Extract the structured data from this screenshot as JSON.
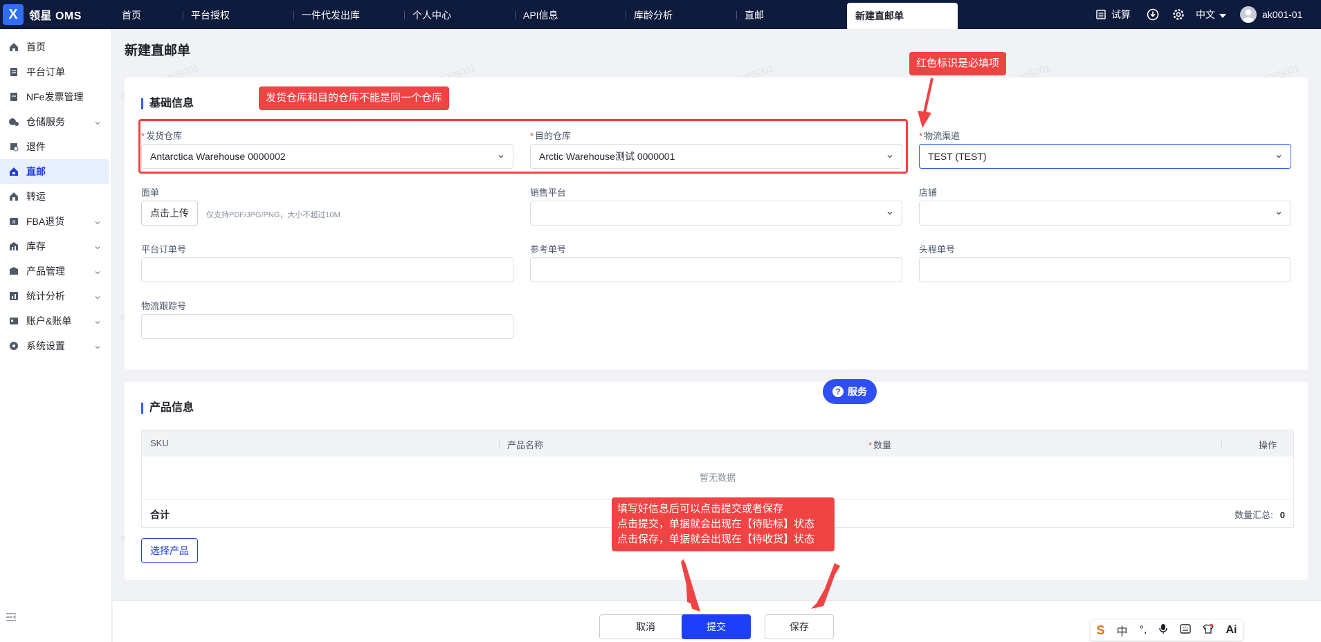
{
  "app": {
    "logo_glyph": "X",
    "name": "领星 OMS"
  },
  "topnav": {
    "items": [
      "首页",
      "平台授权",
      "一件代发出库",
      "个人中心",
      "API信息",
      "库龄分析",
      "直邮"
    ],
    "active": "新建直邮单"
  },
  "topright": {
    "trial": "试算",
    "language": "中文",
    "user": "ak001-01"
  },
  "sidebar": {
    "items": [
      {
        "label": "首页",
        "icon": "home-icon"
      },
      {
        "label": "平台订单",
        "icon": "order-icon"
      },
      {
        "label": "NFe发票管理",
        "icon": "invoice-icon"
      },
      {
        "label": "仓储服务",
        "icon": "warehouse-icon"
      },
      {
        "label": "退件",
        "icon": "return-icon"
      },
      {
        "label": "直邮",
        "icon": "direct-mail-icon"
      },
      {
        "label": "转运",
        "icon": "transfer-icon"
      },
      {
        "label": "FBA退货",
        "icon": "fba-icon"
      },
      {
        "label": "库存",
        "icon": "inventory-icon"
      },
      {
        "label": "产品管理",
        "icon": "product-icon"
      },
      {
        "label": "统计分析",
        "icon": "stats-icon"
      },
      {
        "label": "账户&账单",
        "icon": "account-icon"
      },
      {
        "label": "系统设置",
        "icon": "settings-icon"
      }
    ],
    "active_index": 5,
    "expandable": [
      3,
      7,
      8,
      9,
      10,
      11,
      12
    ]
  },
  "page": {
    "title": "新建直邮单"
  },
  "basic": {
    "title": "基础信息",
    "from_wh": {
      "label": "发货仓库",
      "value": "Antarctica Warehouse 0000002"
    },
    "to_wh": {
      "label": "目的仓库",
      "value": "Arctic Warehouse测试 0000001"
    },
    "channel": {
      "label": "物流渠道",
      "value": "TEST (TEST)"
    },
    "label_sheet": {
      "label": "面单",
      "button": "点击上传",
      "hint": "仅支持PDF/JPG/PNG，大小不超过10M"
    },
    "platform": {
      "label": "销售平台",
      "value": ""
    },
    "shop": {
      "label": "店铺",
      "value": ""
    },
    "platform_order": {
      "label": "平台订单号",
      "value": ""
    },
    "reference": {
      "label": "参考单号",
      "value": ""
    },
    "headhaul": {
      "label": "头程单号",
      "value": ""
    },
    "tracking": {
      "label": "物流跟踪号",
      "value": ""
    }
  },
  "product": {
    "title": "产品信息",
    "columns": {
      "sku": "SKU",
      "name": "产品名称",
      "qty": "数量",
      "ops": "操作"
    },
    "empty": "暂无数据",
    "total_label": "合计",
    "qty_summary_label": "数量汇总:",
    "qty_summary_value": "0",
    "select_button": "选择产品"
  },
  "fab": {
    "label": "服务",
    "icon": "question-icon"
  },
  "footer": {
    "cancel": "取消",
    "submit": "提交",
    "save": "保存"
  },
  "annotations": {
    "warehouse_note": "发货仓库和目的仓库不能是同一个仓库",
    "required_note": "红色标识是必填项",
    "submit_note": [
      "填写好信息后可以点击提交或者保存",
      "点击提交，单据就会出现在【待贴标】状态",
      "点击保存，单据就会出现在【待收货】状态"
    ]
  },
  "ime": {
    "items": [
      "S",
      "中",
      "°,",
      "mic",
      "kbd",
      "shirt",
      "Ai"
    ]
  },
  "watermark": "ak001-01_1005001",
  "colors": {
    "topbar": "#0e1b3d",
    "primary": "#1d3ffa",
    "annotation": "#f04343",
    "active_side_bg": "#e8efff"
  }
}
